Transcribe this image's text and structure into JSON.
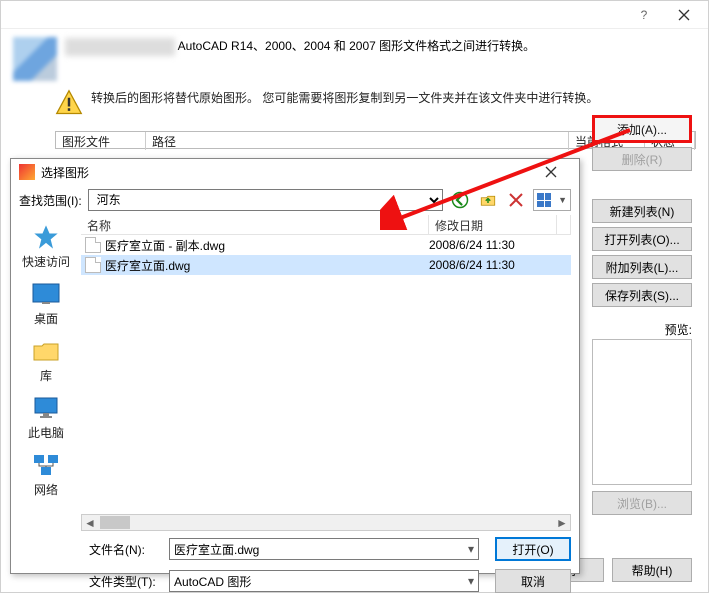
{
  "main": {
    "desc1_suffix": "AutoCAD R14、2000、2004 和 2007 图形文件格式之间进行转换。",
    "warn_text": "转换后的图形将替代原始图形。  您可能需要将图形复制到另一文件夹并在该文件夹中进行转换。",
    "table": {
      "h1": "图形文件",
      "h2": "路径",
      "h3": "当前格式",
      "h4": "状态"
    },
    "buttons": {
      "add": "添加(A)...",
      "remove": "删除(R)",
      "new_list": "新建列表(N)",
      "open_list": "打开列表(O)...",
      "append_list": "附加列表(L)...",
      "save_list": "保存列表(S)..."
    },
    "preview_label": "预览:",
    "browse": "浏览(B)...",
    "cancel": "取消",
    "help": "帮助(H)"
  },
  "dlg": {
    "title": "选择图形",
    "look_in": "查找范围(I):",
    "folder": "河东",
    "places": {
      "quick": "快速访问",
      "desktop": "桌面",
      "lib": "库",
      "pc": "此电脑",
      "net": "网络"
    },
    "cols": {
      "name": "名称",
      "date": "修改日期"
    },
    "files": [
      {
        "name": "医疗室立面 - 副本.dwg",
        "date": "2008/6/24 11:30"
      },
      {
        "name": "医疗室立面.dwg",
        "date": "2008/6/24 11:30"
      }
    ],
    "filename_label": "文件名(N):",
    "filetype_label": "文件类型(T):",
    "filename": "医疗室立面.dwg",
    "filetype": "AutoCAD 图形",
    "open": "打开(O)",
    "cancel": "取消"
  }
}
